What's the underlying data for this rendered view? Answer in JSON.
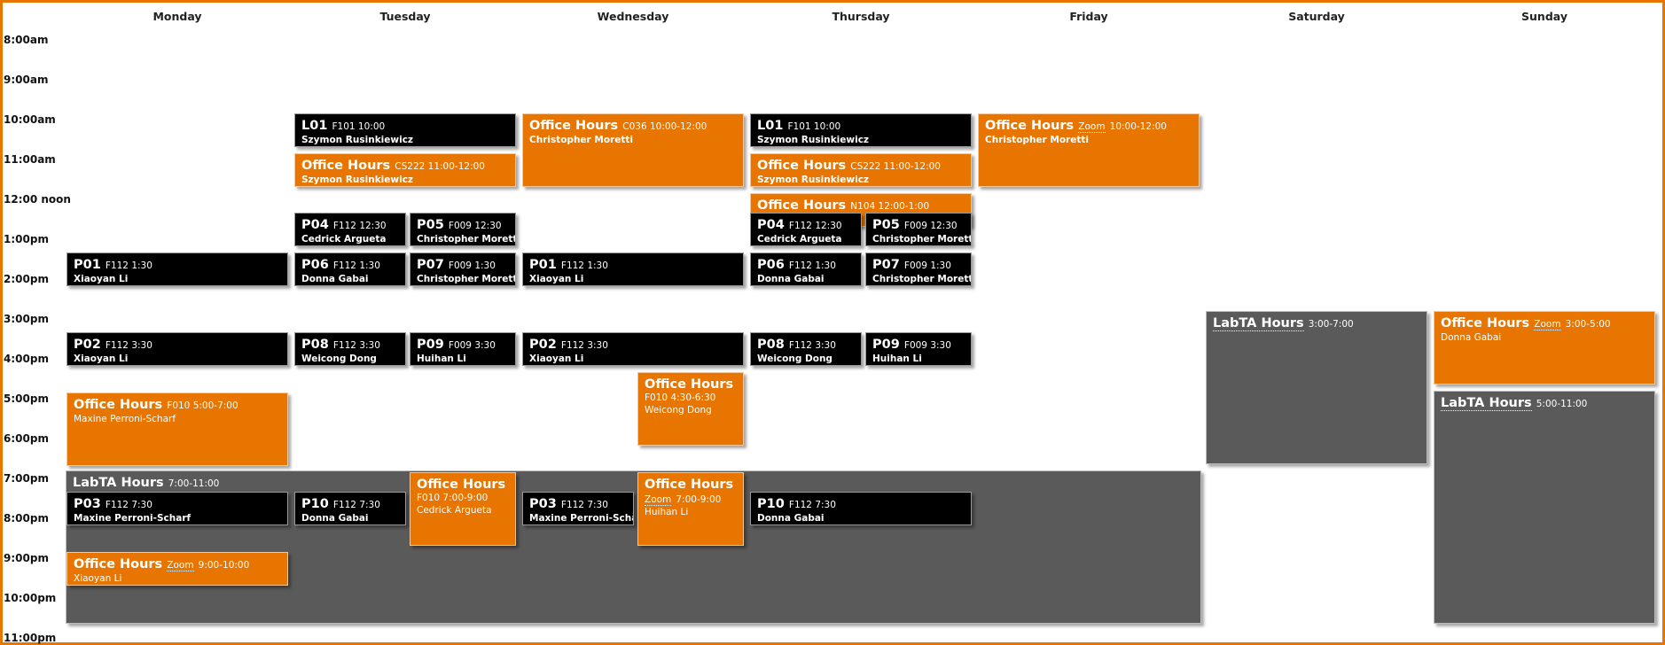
{
  "colors": {
    "lecture": "#000000",
    "office_hours": "#e87500",
    "labta": "#5a5a5a",
    "frame": "#e87500"
  },
  "days": [
    "Monday",
    "Tuesday",
    "Wednesday",
    "Thursday",
    "Friday",
    "Saturday",
    "Sunday"
  ],
  "times": [
    "8:00am",
    "9:00am",
    "10:00am",
    "11:00am",
    "12:00 noon",
    "1:00pm",
    "2:00pm",
    "3:00pm",
    "4:00pm",
    "5:00pm",
    "6:00pm",
    "7:00pm",
    "8:00pm",
    "9:00pm",
    "10:00pm",
    "11:00pm"
  ],
  "events": {
    "labta_weekday": {
      "name": "LabTA Hours",
      "detail": "7:00-11:00"
    },
    "labta_sat": {
      "name": "LabTA Hours",
      "detail": "3:00-7:00"
    },
    "labta_sun": {
      "name": "LabTA Hours",
      "detail": "5:00-11:00"
    },
    "tue_l01": {
      "name": "L01",
      "detail": "F101 10:00",
      "who": "Szymon Rusinkiewicz"
    },
    "thu_l01": {
      "name": "L01",
      "detail": "F101 10:00",
      "who": "Szymon Rusinkiewicz"
    },
    "wed_oh": {
      "name": "Office Hours",
      "detail": "C036 10:00-12:00",
      "who": "Christopher Moretti"
    },
    "fri_oh": {
      "name": "Office Hours",
      "room": "Zoom",
      "detail": "10:00-12:00",
      "who": "Christopher Moretti"
    },
    "tue_oh": {
      "name": "Office Hours",
      "detail": "CS222 11:00-12:00",
      "who": "Szymon Rusinkiewicz"
    },
    "thu_oh": {
      "name": "Office Hours",
      "detail": "CS222 11:00-12:00",
      "who": "Szymon Rusinkiewicz"
    },
    "thu_oh_noon": {
      "name": "Office Hours",
      "detail": "N104 12:00-1:00"
    },
    "tue_p04": {
      "name": "P04",
      "detail": "F112 12:30",
      "who": "Cedrick Argueta"
    },
    "tue_p05": {
      "name": "P05",
      "detail": "F009 12:30",
      "who": "Christopher Moretti"
    },
    "thu_p04": {
      "name": "P04",
      "detail": "F112 12:30",
      "who": "Cedrick Argueta"
    },
    "thu_p05": {
      "name": "P05",
      "detail": "F009 12:30",
      "who": "Christopher Moretti"
    },
    "mon_p01": {
      "name": "P01",
      "detail": "F112 1:30",
      "who": "Xiaoyan Li"
    },
    "tue_p06": {
      "name": "P06",
      "detail": "F112 1:30",
      "who": "Donna Gabai"
    },
    "tue_p07": {
      "name": "P07",
      "detail": "F009 1:30",
      "who": "Christopher Moretti"
    },
    "wed_p01": {
      "name": "P01",
      "detail": "F112 1:30",
      "who": "Xiaoyan Li"
    },
    "thu_p06": {
      "name": "P06",
      "detail": "F112 1:30",
      "who": "Donna Gabai"
    },
    "thu_p07": {
      "name": "P07",
      "detail": "F009 1:30",
      "who": "Christopher Moretti"
    },
    "sun_oh_3": {
      "name": "Office Hours",
      "room": "Zoom",
      "detail": "3:00-5:00",
      "who": "Donna Gabai"
    },
    "mon_p02": {
      "name": "P02",
      "detail": "F112 3:30",
      "who": "Xiaoyan Li"
    },
    "tue_p08": {
      "name": "P08",
      "detail": "F112 3:30",
      "who": "Weicong Dong"
    },
    "tue_p09": {
      "name": "P09",
      "detail": "F009 3:30",
      "who": "Huihan Li"
    },
    "wed_p02": {
      "name": "P02",
      "detail": "F112 3:30",
      "who": "Xiaoyan Li"
    },
    "thu_p08": {
      "name": "P08",
      "detail": "F112 3:30",
      "who": "Weicong Dong"
    },
    "thu_p09": {
      "name": "P09",
      "detail": "F009 3:30",
      "who": "Huihan Li"
    },
    "wed_oh_430": {
      "name": "Office Hours",
      "detail": "F010 4:30-6:30",
      "who": "Weicong Dong"
    },
    "mon_oh_5": {
      "name": "Office Hours",
      "detail": "F010 5:00-7:00",
      "who": "Maxine Perroni-Scharf"
    },
    "mon_p03": {
      "name": "P03",
      "detail": "F112 7:30",
      "who": "Maxine Perroni-Scharf"
    },
    "tue_p10": {
      "name": "P10",
      "detail": "F112 7:30",
      "who": "Donna Gabai"
    },
    "tue_oh_7": {
      "name": "Office Hours",
      "detail": "F010 7:00-9:00",
      "who": "Cedrick Argueta"
    },
    "wed_p03": {
      "name": "P03",
      "detail": "F112 7:30",
      "who": "Maxine Perroni-Scharf"
    },
    "wed_oh_7": {
      "name": "Office Hours",
      "room": "Zoom",
      "detail": "7:00-9:00",
      "who": "Huihan Li"
    },
    "thu_p10": {
      "name": "P10",
      "detail": "F112 7:30",
      "who": "Donna Gabai"
    },
    "mon_oh_9": {
      "name": "Office Hours",
      "room": "Zoom",
      "detail": "9:00-10:00",
      "who": "Xiaoyan Li"
    }
  }
}
